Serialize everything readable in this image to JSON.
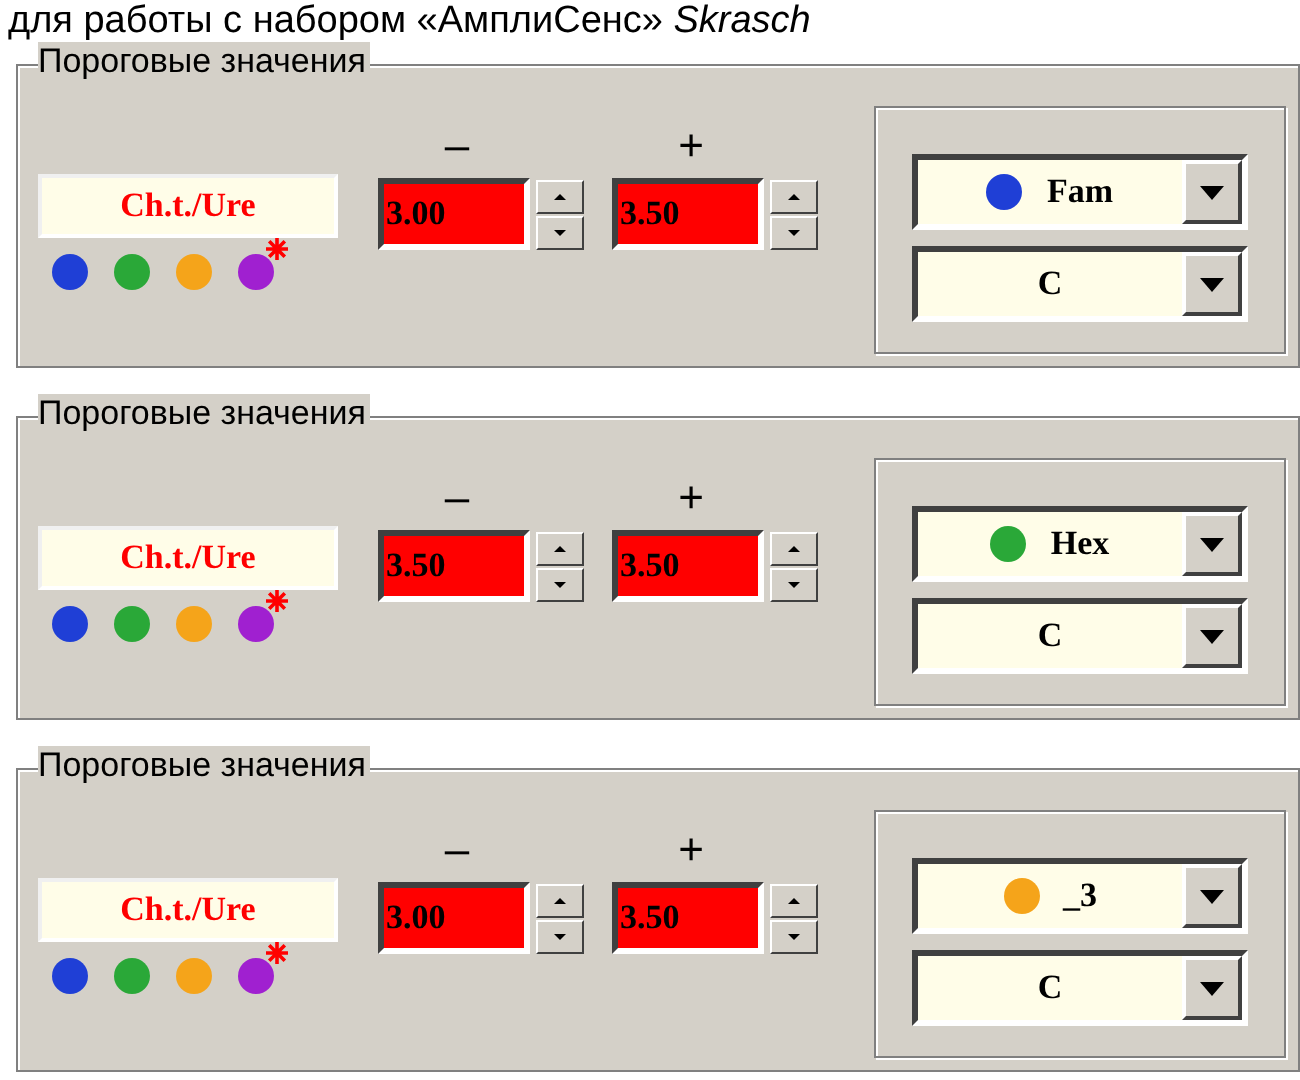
{
  "heading": "для работы с набором «АмплиСенс» *Skrasch*",
  "panels": [
    {
      "title": "Пороговые значения",
      "label": "Ch.t./Ure",
      "dots": [
        {
          "color": "#1f3fd6",
          "starred": false
        },
        {
          "color": "#2aa838",
          "starred": false
        },
        {
          "color": "#f5a41a",
          "starred": false
        },
        {
          "color": "#a020d0",
          "starred": true
        }
      ],
      "minus_header": "–",
      "plus_header": "+",
      "minus_value": "3.00",
      "plus_value": "3.50",
      "channel": {
        "text": "Fam",
        "color": "#1f3fd6"
      },
      "type": "C"
    },
    {
      "title": "Пороговые значения",
      "label": "Ch.t./Ure",
      "dots": [
        {
          "color": "#1f3fd6",
          "starred": false
        },
        {
          "color": "#2aa838",
          "starred": false
        },
        {
          "color": "#f5a41a",
          "starred": false
        },
        {
          "color": "#a020d0",
          "starred": true
        }
      ],
      "minus_header": "–",
      "plus_header": "+",
      "minus_value": "3.50",
      "plus_value": "3.50",
      "channel": {
        "text": "Hex",
        "color": "#2aa838"
      },
      "type": "C"
    },
    {
      "title": "Пороговые значения",
      "label": "Ch.t./Ure",
      "dots": [
        {
          "color": "#1f3fd6",
          "starred": false
        },
        {
          "color": "#2aa838",
          "starred": false
        },
        {
          "color": "#f5a41a",
          "starred": false
        },
        {
          "color": "#a020d0",
          "starred": true
        }
      ],
      "minus_header": "–",
      "plus_header": "+",
      "minus_value": "3.00",
      "plus_value": "3.50",
      "channel": {
        "text": "_3",
        "color": "#f5a41a"
      },
      "type": "C"
    }
  ]
}
